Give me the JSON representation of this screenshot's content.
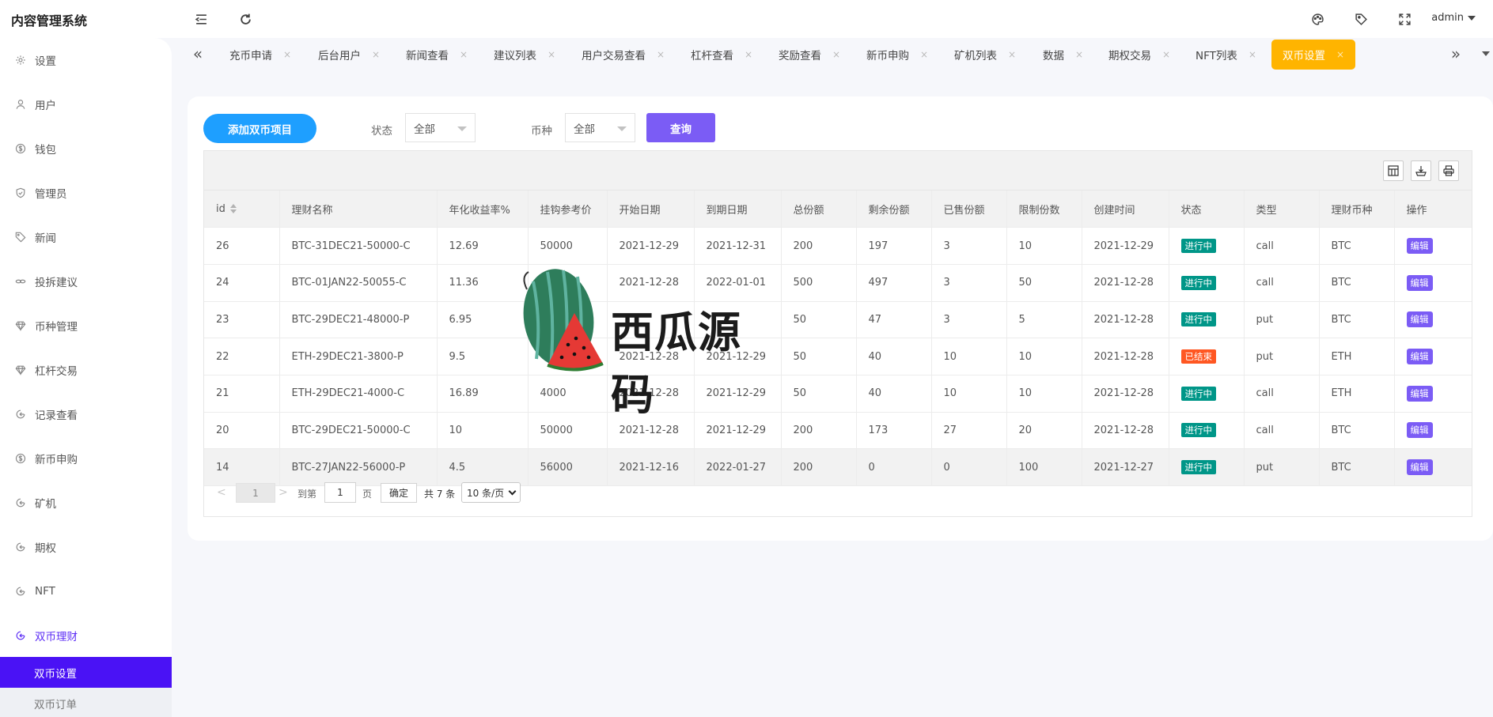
{
  "header": {
    "brand": "内容管理系统",
    "user": "admin"
  },
  "sidebar": {
    "items": [
      {
        "label": "设置",
        "icon": "gear-icon"
      },
      {
        "label": "用户",
        "icon": "user-icon"
      },
      {
        "label": "钱包",
        "icon": "dollar-circle-icon"
      },
      {
        "label": "管理员",
        "icon": "shield-icon"
      },
      {
        "label": "新闻",
        "icon": "tag-icon"
      },
      {
        "label": "投拆建议",
        "icon": "link-icon"
      },
      {
        "label": "币种管理",
        "icon": "diamond-icon"
      },
      {
        "label": "杠杆交易",
        "icon": "diamond-icon"
      },
      {
        "label": "记录查看",
        "icon": "circle-arrow-icon"
      },
      {
        "label": "新币申购",
        "icon": "dollar-circle-icon"
      },
      {
        "label": "矿机",
        "icon": "circle-arrow-icon"
      },
      {
        "label": "期权",
        "icon": "circle-arrow-icon"
      },
      {
        "label": "NFT",
        "icon": "circle-arrow-icon"
      },
      {
        "label": "双币理财",
        "icon": "circle-arrow-icon"
      }
    ],
    "sub_items": [
      {
        "label": "双币设置"
      },
      {
        "label": "双币订单"
      }
    ]
  },
  "tabs": [
    {
      "label": "充币申请"
    },
    {
      "label": "后台用户"
    },
    {
      "label": "新闻查看"
    },
    {
      "label": "建议列表"
    },
    {
      "label": "用户交易查看"
    },
    {
      "label": "杠杆查看"
    },
    {
      "label": "奖励查看"
    },
    {
      "label": "新币申购"
    },
    {
      "label": "矿机列表"
    },
    {
      "label": "数据"
    },
    {
      "label": "期权交易"
    },
    {
      "label": "NFT列表"
    },
    {
      "label": "双币设置"
    }
  ],
  "tab_close": "×",
  "toolbar": {
    "add_label": "添加双币项目",
    "status_label": "状态",
    "status_value": "全部",
    "coin_label": "币种",
    "coin_value": "全部",
    "query_label": "查询"
  },
  "table": {
    "columns": [
      "id",
      "理财名称",
      "年化收益率%",
      "挂钩参考价",
      "开始日期",
      "到期日期",
      "总份额",
      "剩余份额",
      "已售份额",
      "限制份数",
      "创建时间",
      "状态",
      "类型",
      "理财币种",
      "操作"
    ],
    "rows": [
      {
        "id": "26",
        "name": "BTC-31DEC21-50000-C",
        "rate": "12.69",
        "ref_price": "50000",
        "start": "2021-12-29",
        "end": "2021-12-31",
        "total": "200",
        "remain": "197",
        "sold": "3",
        "limit": "10",
        "created": "2021-12-29",
        "status": "进行中",
        "type": "call",
        "coin": "BTC",
        "action": "编辑"
      },
      {
        "id": "24",
        "name": "BTC-01JAN22-50055-C",
        "rate": "11.36",
        "ref_price": "",
        "start": "2021-12-28",
        "end": "2022-01-01",
        "total": "500",
        "remain": "497",
        "sold": "3",
        "limit": "50",
        "created": "2021-12-28",
        "status": "进行中",
        "type": "call",
        "coin": "BTC",
        "action": "编辑"
      },
      {
        "id": "23",
        "name": "BTC-29DEC21-48000-P",
        "rate": "6.95",
        "ref_price": "",
        "start": "",
        "end": "",
        "total": "50",
        "remain": "47",
        "sold": "3",
        "limit": "5",
        "created": "2021-12-28",
        "status": "进行中",
        "type": "put",
        "coin": "BTC",
        "action": "编辑"
      },
      {
        "id": "22",
        "name": "ETH-29DEC21-3800-P",
        "rate": "9.5",
        "ref_price": "",
        "start": "2021-12-28",
        "end": "2021-12-29",
        "total": "50",
        "remain": "40",
        "sold": "10",
        "limit": "10",
        "created": "2021-12-28",
        "status": "已结束",
        "type": "put",
        "coin": "ETH",
        "action": "编辑"
      },
      {
        "id": "21",
        "name": "ETH-29DEC21-4000-C",
        "rate": "16.89",
        "ref_price": "4000",
        "start": "2021-12-28",
        "end": "2021-12-29",
        "total": "50",
        "remain": "40",
        "sold": "10",
        "limit": "10",
        "created": "2021-12-28",
        "status": "进行中",
        "type": "call",
        "coin": "ETH",
        "action": "编辑"
      },
      {
        "id": "20",
        "name": "BTC-29DEC21-50000-C",
        "rate": "10",
        "ref_price": "50000",
        "start": "2021-12-28",
        "end": "2021-12-29",
        "total": "200",
        "remain": "173",
        "sold": "27",
        "limit": "20",
        "created": "2021-12-28",
        "status": "进行中",
        "type": "call",
        "coin": "BTC",
        "action": "编辑"
      },
      {
        "id": "14",
        "name": "BTC-27JAN22-56000-P",
        "rate": "4.5",
        "ref_price": "56000",
        "start": "2021-12-16",
        "end": "2022-01-27",
        "total": "200",
        "remain": "0",
        "sold": "0",
        "limit": "100",
        "created": "2021-12-27",
        "status": "进行中",
        "type": "put",
        "coin": "BTC",
        "action": "编辑"
      }
    ]
  },
  "pager": {
    "current": "1",
    "goto_label": "到第",
    "goto_value": "1",
    "page_unit": "页",
    "confirm": "确定",
    "total": "共 7 条",
    "page_size": "10 条/页"
  },
  "watermark": {
    "text": "西瓜源码"
  },
  "colors": {
    "accent": "#4a12f5",
    "primary_blue": "#1e9fff",
    "query_purple": "#7b5cf5",
    "active_tab": "#ffb400",
    "status_running": "#009688",
    "status_ended": "#ff5722"
  }
}
